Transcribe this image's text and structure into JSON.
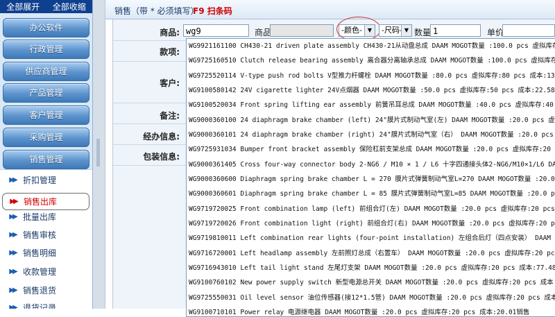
{
  "sidebar": {
    "top": {
      "expand_all": "全部展开",
      "collapse_all": "全部收缩"
    },
    "groups": [
      "办公软件",
      "行政管理",
      "供应商管理",
      "产品管理",
      "客户管理",
      "采购管理",
      "销售管理"
    ],
    "items": [
      {
        "label": "折扣管理",
        "active": false
      },
      {
        "label": "销售出库",
        "active": true
      },
      {
        "label": "批量出库",
        "active": false
      },
      {
        "label": "销售审核",
        "active": false
      },
      {
        "label": "销售明细",
        "active": false
      },
      {
        "label": "收款管理",
        "active": false
      },
      {
        "label": "销售退货",
        "active": false
      },
      {
        "label": "退货记录",
        "active": false
      }
    ]
  },
  "main": {
    "title": "销售（带 * 必须填写）",
    "shortcut": "F9 扫条码",
    "fields": {
      "product_label": "商品:",
      "product_value": "wg9",
      "product2_label": "商品",
      "color_select": "-颜色-",
      "size_select": "-尺码-",
      "qty_label": "数量",
      "qty_value": "1",
      "unit_price_label": "单价",
      "payment_label": "款项:",
      "customer_label": "客户:",
      "remark_label": "备注:",
      "handler_label": "经办信息:",
      "package_label": "包装信息:"
    }
  },
  "dropdown": {
    "rows": [
      "WG9921161100 CH430-21 driven plate assembly CH430-21从动盘总成 DAAM MOGOT数量 :100.0 pcs 虚拟库存:100.0 pcs",
      "WG9725160510 Clutch release bearing assembly 离合器分离轴承总成 DAAM MOGOT数量 :100.0 pcs 虚拟库存:100.0",
      "WG9725520114 V-type push rod bolts V型推力杆螺栓 DAAM MOGOT数量 :80.0 pcs 虚拟库存:80 pcs 成本:13.1",
      "WG9100580142 24V cigarette lighter 24V点烟器 DAAM MOGOT数量 :50.0 pcs 虚拟库存:50 pcs 成本:22.58销",
      "WG9100520034 Front spring lifting ear assembly 前簧吊耳总成 DAAM MOGOT数量 :40.0 pcs 虚拟库存:40 pc",
      "WG9000360100 24 diaphragm brake chamber (left) 24\"膜片式制动气室(左) DAAM MOGOT数量 :20.0 pcs 虚拟",
      "WG9000360101 24 diaphragm brake chamber (right) 24\"膜片式制动气室（右） DAAM MOGOT数量 :20.0 pcs 虚",
      "WG9725931034 Bumper front bracket assembly 保险杠前支架总成 DAAM MOGOT数量 :20.0 pcs 虚拟库存:20 p",
      "WG9000361405 Cross four-way connector body 2-NG6 / M10 × 1 / L6 十字四通接头体2-NG6/M10×1/L6 DAAM",
      "WG9000360600 Diaphragm spring brake chamber L = 270 膜片式弹簧制动气室L=270 DAAM MOGOT数量 :20.0 pcs",
      "WG9000360601 Diaphragm spring brake chamber L = 85 膜片式弹簧制动气室L=85 DAAM MOGOT数量 :20.0 pcs",
      "WG9719720025 Front combination lamp (left) 前组合灯(左) DAAM MOGOT数量 :20.0 pcs 虚拟库存:20 pcs 成",
      "WG9719720026 Front combination light (right) 前组合灯(右) DAAM MOGOT数量 :20.0 pcs 虚拟库存:20 pcs",
      "WG9719810011 Left combination rear lights (four-point installation) 左组合后灯（四点安装） DAAM MOGO",
      "WG9716720001 Left headlamp assembly 左前照灯总成（右置车） DAAM MOGOT数量 :20.0 pcs 虚拟库存:20 pcs",
      "WG9716943010 Left tail light stand 左尾灯支架 DAAM MOGOT数量 :20.0 pcs 虚拟库存:20 pcs 成本:77.48销",
      "WG9100760102 New power supply switch 新型电源总开关 DAAM MOGOT数量 :20.0 pcs 虚拟库存:20 pcs 成本:8",
      "WG9725550031 Oil level sensor 油位传感器(接12*1.5管) DAAM MOGOT数量 :20.0 pcs 虚拟库存:20 pcs 成本:",
      "WG9100710101 Power relay 电源继电器 DAAM MOGOT数量 :20.0 pcs 虚拟库存:20 pcs 成本:20.01销售"
    ]
  }
}
